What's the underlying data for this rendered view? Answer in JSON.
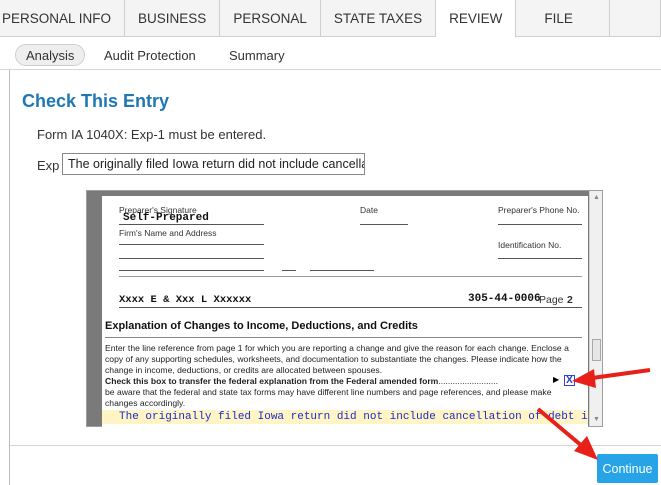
{
  "nav": {
    "tabs": [
      "PERSONAL INFO",
      "BUSINESS",
      "PERSONAL",
      "STATE TAXES",
      "REVIEW",
      "FILE"
    ],
    "active": "REVIEW"
  },
  "subnav": {
    "tabs": [
      "Analysis",
      "Audit Protection",
      "Summary"
    ],
    "active": "Analysis"
  },
  "main": {
    "title": "Check This Entry",
    "message": "Form IA 1040X: Exp-1 must be entered.",
    "exp_label": "Exp",
    "exp_value": "The originally filed Iowa return did not include cancellation of debt income"
  },
  "form": {
    "preparer_sig_label": "Preparer's Signature",
    "preparer_sig_value": "Self-Prepared",
    "date_label": "Date",
    "phone_label": "Preparer's Phone No.",
    "firm_label": "Firm's Name and Address",
    "id_label": "Identification  No.",
    "name_value": "Xxxx E & Xxx L Xxxxxx",
    "ssn_value": "305-44-0006",
    "page_label": "Page",
    "page_num": "2",
    "heading": "Explanation of Changes to Income, Deductions, and Credits",
    "para1": "Enter the line reference from page 1 for which you are reporting a change and give the reason for each change. Enclose a copy of any supporting schedules, worksheets, and documentation to substantiate the changes. Please indicate how the change in income, deductions, or credits are allocated between spouses.",
    "para_bold": "Check this box to transfer the federal explanation from the Federal amended form",
    "para_dots": ".........................",
    "para2": "be aware that the federal and state tax forms may have different line numbers and page references, and please make changes accordingly.",
    "check_mark": "X",
    "explanation_line": "The originally filed Iowa return did not include cancellation of debt income"
  },
  "footer": {
    "continue_label": "Continue"
  },
  "colors": {
    "title": "#1e78b4",
    "button": "#27a3e8",
    "annotation_arrow": "#e8201a",
    "highlight": "#fff4c4"
  }
}
